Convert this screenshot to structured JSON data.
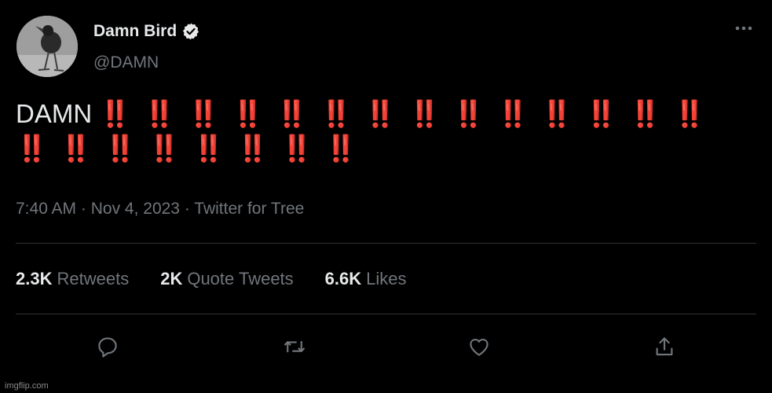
{
  "author": {
    "display_name": "Damn Bird",
    "handle": "@DAMN",
    "verified": true
  },
  "tweet": {
    "word": "DAMN",
    "emphasis": "‼️ ‼️ ‼️ ‼️ ‼️ ‼️ ‼️ ‼️ ‼️ ‼️ ‼️ ‼️ ‼️ ‼️ ‼️ ‼️ ‼️ ‼️ ‼️ ‼️ ‼️ ‼️"
  },
  "meta": {
    "time": "7:40 AM",
    "sep1": " · ",
    "date": "Nov 4, 2023",
    "sep2": " · ",
    "source": "Twitter for Tree"
  },
  "stats": {
    "retweets_count": "2.3K",
    "retweets_label": "Retweets",
    "quotes_count": "2K",
    "quotes_label": "Quote Tweets",
    "likes_count": "6.6K",
    "likes_label": "Likes"
  },
  "icons": {
    "more": "more-horizontal-icon",
    "reply": "reply-icon",
    "retweet": "retweet-icon",
    "like": "heart-icon",
    "share": "share-icon",
    "verified": "verified-badge-icon"
  },
  "colors": {
    "background": "#000000",
    "text": "#e7e9ea",
    "secondary": "#71767b",
    "divider": "#2f3336",
    "emphasis": "#e0213a"
  },
  "watermark": "imgflip.com"
}
